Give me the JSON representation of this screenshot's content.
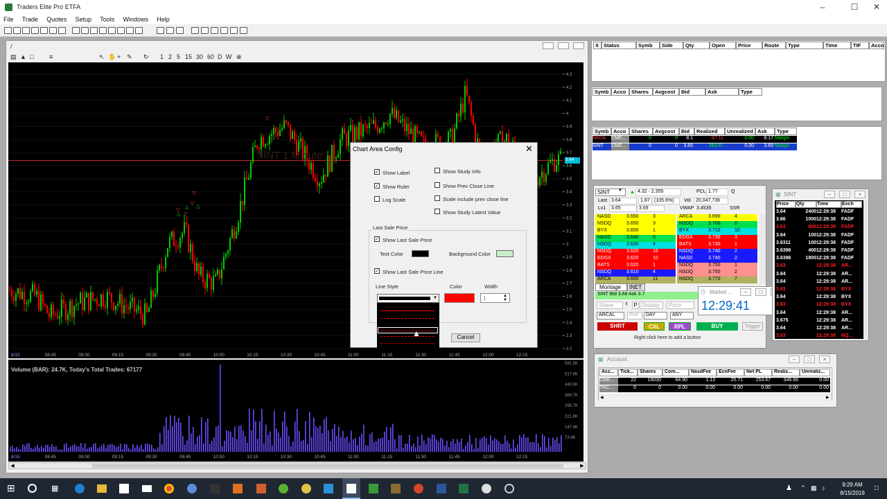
{
  "app": {
    "title": "Traders Elite Pro ETFA"
  },
  "menu": [
    "File",
    "Trade",
    "Quotes",
    "Setup",
    "Tools",
    "Windows",
    "Help"
  ],
  "chart": {
    "window_title": "/",
    "toolbar_intervals": [
      "1",
      "2",
      "5",
      "15",
      "30",
      "60",
      "D",
      "W"
    ],
    "watermark": "SINT 1 Minute",
    "last_price_tag": "3.64",
    "price_ticks": [
      "4.3",
      "4.2",
      "4.1",
      "4",
      "3.9",
      "3.8",
      "3.7",
      "3.6",
      "3.5",
      "3.4",
      "3.3",
      "3.2",
      "3.1",
      "3",
      "2.9",
      "2.8",
      "2.7",
      "2.6",
      "2.5",
      "2.4",
      "2.3",
      "2.2"
    ],
    "time_ticks": [
      "8/15",
      "08:45",
      "09:00",
      "09:15",
      "09:30",
      "09:45",
      "10:00",
      "10:15",
      "10:30",
      "10:45",
      "11:00",
      "11:15",
      "11:30",
      "11:45",
      "12:00",
      "12:15"
    ],
    "volume_label": "Volume (BAR): 24.7K, Today's Total Trades: 67177",
    "volume_ticks": [
      "591.5K",
      "517.6K",
      "443.6K",
      "369.7K",
      "295.7K",
      "221.8K",
      "147.9K",
      "73.9K"
    ],
    "colors": {
      "up": "#00cc00",
      "down": "#ff0000",
      "volume": "#6a4cff",
      "line": "#c62828"
    }
  },
  "dialog": {
    "title": "Chart Area Config",
    "close": "✕",
    "checks_left": [
      {
        "label": "Show Label",
        "checked": true
      },
      {
        "label": "Show Ruler",
        "checked": true
      },
      {
        "label": "Log Scale",
        "checked": false
      }
    ],
    "checks_right": [
      {
        "label": "Show Study Info",
        "checked": false
      },
      {
        "label": "Show Prev Close Line",
        "checked": false
      },
      {
        "label": "Scale include prev close line",
        "checked": false
      },
      {
        "label": "Show Study Latest Value",
        "checked": false
      }
    ],
    "group_title": "Last Sale Price",
    "show_last_sale_price": "Show Last Sale Price",
    "text_color_label": "Text Color",
    "text_color": "#000000",
    "background_color_label": "Background Color",
    "background_color": "#c8f0c8",
    "show_last_sale_line": "Show Last Sale Price Line",
    "line_style_label": "Line Style",
    "color_label": "Color",
    "line_color": "#ff0000",
    "width_label": "Width",
    "width_value": "1",
    "cancel": "Cancel"
  },
  "orders": {
    "headers": [
      "X",
      "Status",
      "Symb",
      "Side",
      "Qty",
      "Open",
      "Price",
      "Route",
      "Type",
      "Time",
      "TIF",
      "Acco"
    ]
  },
  "positions_open": {
    "headers": [
      "Symb",
      "Acco",
      "Shares",
      "Avgcost",
      "Bid",
      "Ask",
      "Type"
    ]
  },
  "positions": {
    "headers": [
      "Symb",
      "Acco",
      "Shares",
      "Avgcost",
      "Bid",
      "Realized",
      "Unrealized",
      "Ask",
      "Type"
    ],
    "rows": [
      [
        "RKDA",
        "CME...",
        "0",
        "0",
        "8.1",
        "-47.11",
        "0.00",
        "8.17",
        "Margin"
      ],
      [
        "SINT",
        "CME...",
        "0",
        "0",
        "3.65",
        "393.67",
        "0.00",
        "3.69",
        "Margin"
      ]
    ]
  },
  "montage": {
    "symbol": "SINT",
    "change": "4.32 - 2.355",
    "pcl_label": "PCL",
    "pcl": "1.77",
    "q": "Q",
    "last_label": "Last",
    "last": "3.64",
    "chg": "1.87",
    "chg_pct": "(105.6%)",
    "vol_label": "Vol",
    "vol": "20,047,736",
    "lv1_label": "Lv1",
    "bid": "3.65",
    "ask": "3.69",
    "vwap_label": "VWAP",
    "vwap": "3.4535",
    "ssr": "SSR",
    "bids": [
      [
        "NASD",
        "3.650",
        "3",
        "#ffff00"
      ],
      [
        "NSDQ",
        "3.650",
        "3",
        "#ffff00"
      ],
      [
        "BYX",
        "3.650",
        "1",
        "#ffff00"
      ],
      [
        "NASD",
        "3.640",
        "0",
        "#00e050"
      ],
      [
        "NSDQ",
        "3.630",
        "4",
        "#00e0e0"
      ],
      [
        "NSDQ",
        "3.620",
        "16",
        "#ff0000"
      ],
      [
        "EDGX",
        "3.620",
        "10",
        "#ff0000"
      ],
      [
        "BATS",
        "3.620",
        "1",
        "#ff0000"
      ],
      [
        "NSDQ",
        "3.610",
        "4",
        "#1a1aff"
      ],
      [
        "ARCA",
        "3.600",
        "11",
        "#b0b060"
      ]
    ],
    "asks": [
      [
        "ARCA",
        "3.690",
        "4",
        "#ffff00"
      ],
      [
        "NSDQ",
        "3.700",
        "0",
        "#00e050"
      ],
      [
        "BYX",
        "3.710",
        "10",
        "#00e0e0"
      ],
      [
        "EDGX",
        "3.730",
        "3",
        "#ff0000"
      ],
      [
        "BATS",
        "3.730",
        "1",
        "#ff0000"
      ],
      [
        "NSDQ",
        "3.740",
        "2",
        "#1a1aff"
      ],
      [
        "NASD",
        "3.740",
        "2",
        "#1a1aff"
      ],
      [
        "NSDQ",
        "3.750",
        "1",
        "#ff9090"
      ],
      [
        "NSDQ",
        "3.750",
        "2",
        "#ff9090"
      ],
      [
        "NSDQ",
        "3.770",
        "7",
        "#b0b060"
      ]
    ],
    "tabs": [
      "Montage",
      "INET"
    ],
    "status": "SINT Bid 3.68 Ask 3.7",
    "share_label": "Share",
    "p_label": "P",
    "display_label": "Display",
    "price_label": "Price",
    "route": "ARCAL",
    "pref_label": "Pref",
    "tif": "DAY",
    "any": "ANY",
    "buttons": {
      "shrt": "SHRT",
      "cxl": "CXL",
      "rpl": "RPL",
      "buy": "BUY",
      "trigger": "Trigger"
    },
    "hint": "Right click here to add a button"
  },
  "clock": {
    "title": "Market ...",
    "time": "12:29:41"
  },
  "ts": {
    "title": "SINT",
    "headers": [
      "Price",
      "Qty",
      "Time",
      "Exch"
    ],
    "rows": [
      [
        "3.64",
        "2400",
        "12:29:38",
        "FADF",
        "w"
      ],
      [
        "3.66",
        "1000",
        "12:29:38",
        "FADF",
        "w"
      ],
      [
        "3.63",
        "800",
        "12:29:38",
        "FADF",
        "r"
      ],
      [
        "3.64",
        "100",
        "12:29:38",
        "FADF",
        "w"
      ],
      [
        "3.6311",
        "100",
        "12:29:38",
        "FADF",
        "w"
      ],
      [
        "3.6396",
        "400",
        "12:29:38",
        "FADF",
        "w"
      ],
      [
        "3.6396",
        "1800",
        "12:29:38",
        "FADF",
        "w"
      ],
      [
        "3.63",
        "",
        "12:29:38",
        "AR...",
        "r"
      ],
      [
        "3.64",
        "",
        "12:29:38",
        "AR...",
        "w"
      ],
      [
        "3.64",
        "",
        "12:29:38",
        "AR...",
        "w"
      ],
      [
        "3.63",
        "",
        "12:29:38",
        "BYX",
        "r"
      ],
      [
        "3.64",
        "",
        "12:29:38",
        "BYX",
        "w"
      ],
      [
        "3.63",
        "",
        "12:29:38",
        "BYX",
        "r"
      ],
      [
        "3.64",
        "",
        "12:29:38",
        "AR...",
        "w"
      ],
      [
        "3.675",
        "",
        "12:29:38",
        "AR...",
        "w"
      ],
      [
        "3.64",
        "",
        "12:29:38",
        "AR...",
        "w"
      ],
      [
        "3.63",
        "",
        "12:29:38",
        "NQ...",
        "r"
      ]
    ]
  },
  "account": {
    "title": "Account",
    "headers": [
      "Acc...",
      "Tick...",
      "Shares",
      "Com...",
      "NasdFee",
      "EcnFee",
      "Net PL",
      "Realiz...",
      "Unrealiz..."
    ],
    "rows": [
      [
        "CME...",
        "22",
        "19030",
        "64.90",
        "1.13",
        "25.71",
        "253.67",
        "346.66",
        "0.00"
      ],
      [
        "TRC...",
        "0",
        "0",
        "0.00",
        "0.00",
        "0.00",
        "0.00",
        "0.00",
        "0.00"
      ]
    ]
  },
  "taskbar": {
    "time": "9:29 AM",
    "date": "8/15/2019"
  }
}
